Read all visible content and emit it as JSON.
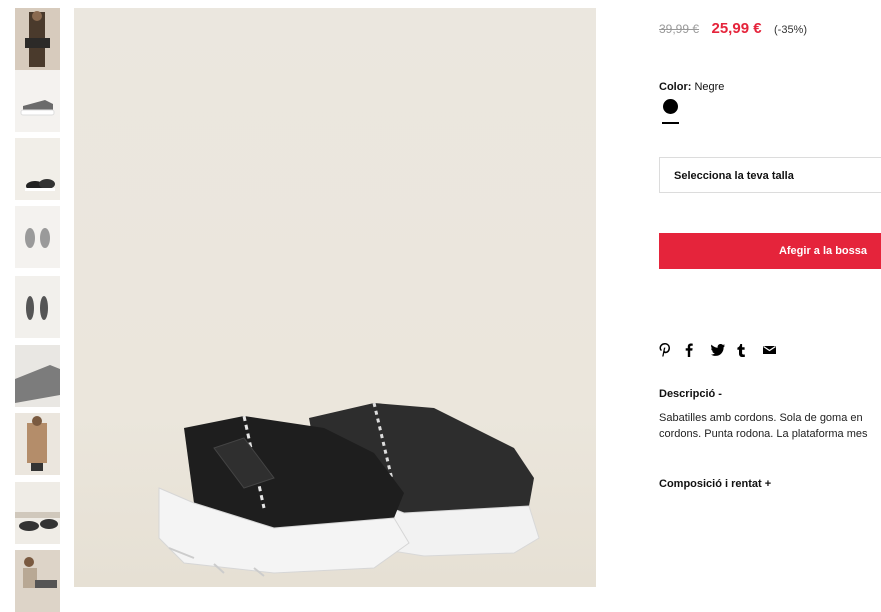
{
  "gallery": {
    "thumbnails": [
      {
        "label": "model-full",
        "bg": "#c9b9a8"
      },
      {
        "label": "shoe-side",
        "bg": "#f3f1ee"
      },
      {
        "label": "shoe-pair-front",
        "bg": "#f0ede7"
      },
      {
        "label": "shoe-pair-top",
        "bg": "#f3f1ee"
      },
      {
        "label": "shoe-pair-top-2",
        "bg": "#f1efeb"
      },
      {
        "label": "shoe-close",
        "bg": "#e8e6e2"
      },
      {
        "label": "model-coat",
        "bg": "#e9e4dc"
      },
      {
        "label": "shoes-on-feet",
        "bg": "#efece6"
      },
      {
        "label": "model-sitting",
        "bg": "#d8cfc2"
      }
    ]
  },
  "product": {
    "old_price": "39,99 €",
    "new_price": "25,99 €",
    "discount": "(-35%)",
    "color_label": "Color:",
    "color_value": "Negre",
    "swatch_color": "#000000",
    "size_placeholder": "Selecciona la teva talla",
    "add_to_bag": "Afegir a la bossa",
    "description_title": "Descripció -",
    "description_lines": [
      "Sabatilles amb cordons. Sola de goma en",
      "cordons. Punta rodona. La plataforma mes"
    ],
    "composition_title": "Composició i rentat +"
  },
  "share": {
    "pinterest": "P",
    "facebook": "f",
    "twitter": "t",
    "tumblr": "t",
    "email": "✉"
  },
  "colors": {
    "accent": "#e5243b",
    "main_bg": "#ece8e0"
  }
}
